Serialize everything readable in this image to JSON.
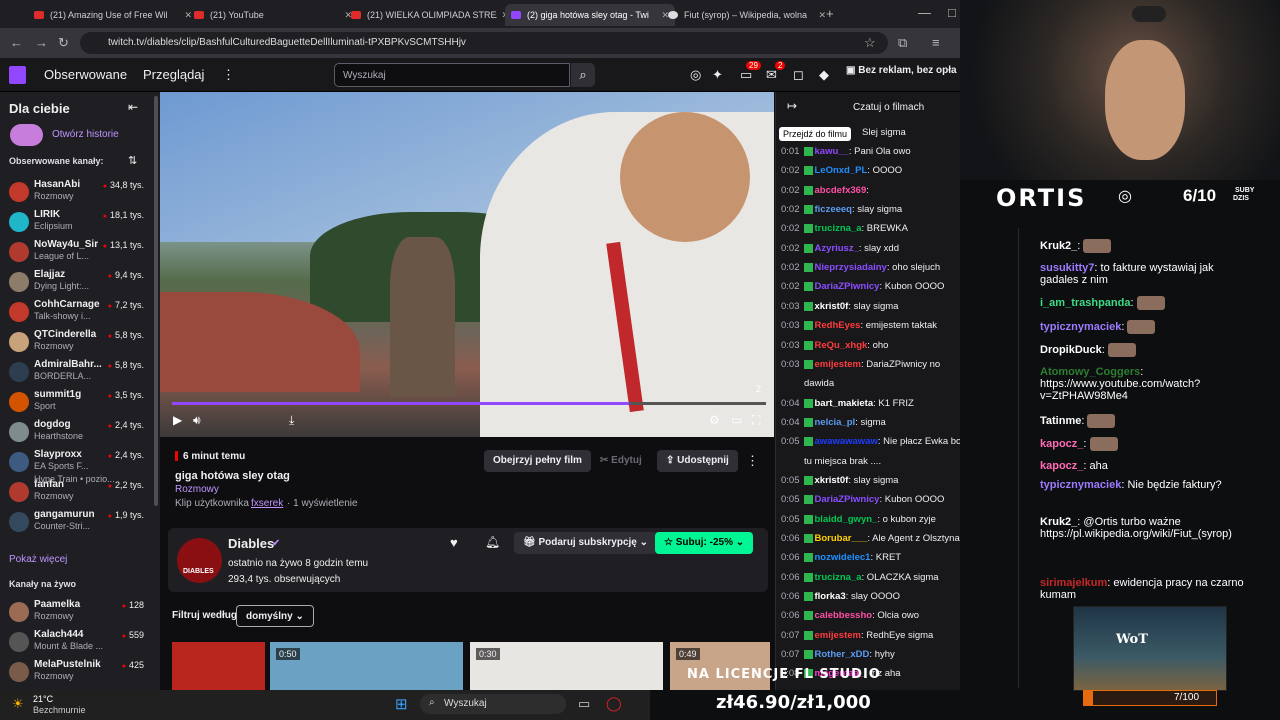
{
  "browser": {
    "tabs": [
      {
        "title": "(21) Amazing Use of Free Wil",
        "kind": "yt"
      },
      {
        "title": "(21) YouTube",
        "kind": "yt"
      },
      {
        "title": "(21) WIELKA OLIMPIADA STREA",
        "kind": "yt"
      },
      {
        "title": "(2) giga hotówa sley otag - Twi",
        "kind": "tw"
      },
      {
        "title": "Fiut (syrop) – Wikipedia, wolna",
        "kind": "wk"
      }
    ],
    "url": "twitch.tv/diables/clip/BashfulCulturedBaguetteDellIluminati-tPXBPKvSCMTSHHjv"
  },
  "topnav": {
    "following": "Obserwowane",
    "browse": "Przeglądaj",
    "search_placeholder": "Wyszukaj",
    "badge_notifications": "29",
    "badge_inbox": "2",
    "no_ads": "Bez reklam, bez opła"
  },
  "sidebar": {
    "for_you": "Dla ciebie",
    "open_stories": "Otwórz historie",
    "followed_channels": "Obserwowane kanały:",
    "channels": [
      {
        "name": "HasanAbi",
        "game": "Rozmowy",
        "viewers": "34,8 tys.",
        "color": "#c0392b"
      },
      {
        "name": "LIRIK",
        "game": "Eclipsium",
        "viewers": "18,1 tys.",
        "color": "#1fb6c9"
      },
      {
        "name": "NoWay4u_Sir",
        "game": "League of L...",
        "viewers": "13,1 tys.",
        "color": "#b03a2e"
      },
      {
        "name": "Elajjaz",
        "game": "Dying Light:...",
        "viewers": "9,4 tys.",
        "color": "#8e7c6a"
      },
      {
        "name": "CohhCarnage",
        "game": "Talk-showy i...",
        "viewers": "7,2 tys.",
        "color": "#c0392b"
      },
      {
        "name": "QTCinderella",
        "game": "Rozmowy",
        "viewers": "5,8 tys.",
        "color": "#c8a27a"
      },
      {
        "name": "AdmiralBahr...",
        "game": "BORDERLA...",
        "viewers": "5,8 tys.",
        "color": "#2c3e50"
      },
      {
        "name": "summit1g",
        "game": "Sport",
        "viewers": "3,5 tys.",
        "color": "#d35400"
      },
      {
        "name": "dogdog",
        "game": "Hearthstone",
        "viewers": "2,4 tys.",
        "color": "#7f8c8d"
      },
      {
        "name": "Slayproxx",
        "game": "EA Sports F...",
        "viewers": "2,4 tys.",
        "color": "#3d5a80"
      },
      {
        "name": "fanfan",
        "game": "Rozmowy",
        "viewers": "2,2 tys.",
        "color": "#b03a2e"
      },
      {
        "name": "gangamurun",
        "game": "Counter-Stri...",
        "viewers": "1,9 tys.",
        "color": "#34495e"
      }
    ],
    "hype_train": "Hype Train • pozio...",
    "show_more": "Pokaż więcej",
    "live_channels": "Kanały na żywo",
    "live": [
      {
        "name": "Paamelka",
        "game": "Rozmowy",
        "viewers": "128",
        "color": "#9c6b54"
      },
      {
        "name": "Kalach444",
        "game": "Mount & Blade ...",
        "viewers": "559",
        "color": "#555"
      },
      {
        "name": "MelaPustelnik",
        "game": "Rozmowy",
        "viewers": "425",
        "color": "#7a5a48"
      }
    ]
  },
  "video": {
    "progress": 0.77,
    "corner_num": "2"
  },
  "clip": {
    "age": "6 minut temu",
    "title": "giga hotówa sley otag",
    "category": "Rozmowy",
    "clip_by": "Klip użytkownika",
    "clipper": "fxserek",
    "views": "· 1 wyświetlenie",
    "watch_full": "Obejrzyj pełny film",
    "edit": "Edytuj",
    "share": "Udostępnij"
  },
  "channel": {
    "name": "Diables",
    "last_live": "ostatnio na żywo 8 godzin temu",
    "followers": "293,4 tys. obserwujących",
    "gift": "Podaruj subskrypcję",
    "subscribe": "Subuj: -25%",
    "filter_label": "Filtruj według",
    "filter_value": "domyślny",
    "avatar_text": "DIABLES"
  },
  "thumbs": [
    {
      "dur": "0:50"
    },
    {
      "dur": "0:30"
    },
    {
      "dur": "0:49"
    }
  ],
  "chat": {
    "header": "Czatuj o filmach",
    "tooltip": "Przejdź do filmu",
    "partial": "Slej sigma",
    "messages": [
      {
        "t": "0:01",
        "u": "kawu__",
        "m": "Pani Ola owo",
        "c": "#9147ff"
      },
      {
        "t": "0:02",
        "u": "LeOnxd_PL",
        "m": "OOOO",
        "c": "#1e90ff"
      },
      {
        "t": "0:02",
        "u": "abcdefx369",
        "m": "",
        "c": "#ff4fa3"
      },
      {
        "t": "0:02",
        "u": "ficzeeeq",
        "m": "slay sigma",
        "c": "#5b9cf2"
      },
      {
        "t": "0:02",
        "u": "trucizna_a",
        "m": "BREWKA",
        "c": "#00c853"
      },
      {
        "t": "0:02",
        "u": "Azyriusz_",
        "m": "slay xdd",
        "c": "#8a4dff"
      },
      {
        "t": "0:02",
        "u": "Nieprzysiadainy",
        "m": "oho slejuch",
        "c": "#8a4dff"
      },
      {
        "t": "0:02",
        "u": "DariaZPiwnicy",
        "m": "Kubon OOOO",
        "c": "#8a4dff"
      },
      {
        "t": "0:03",
        "u": "xkrist0f",
        "m": "slay sigma",
        "c": "#ffffff"
      },
      {
        "t": "0:03",
        "u": "RedhEyes",
        "m": "emijestem taktak",
        "c": "#ff3b3b"
      },
      {
        "t": "0:03",
        "u": "ReQu_xhgk",
        "m": "oho",
        "c": "#ff3b3b"
      },
      {
        "t": "0:03",
        "u": "emijestem",
        "m": "DariaZPiwnicy no",
        "c": "#ff3b3b"
      },
      {
        "t": "",
        "u": "",
        "m": "dawida",
        "c": "#ffffff"
      },
      {
        "t": "0:04",
        "u": "bart_makieta",
        "m": "K1 FRIZ",
        "c": "#ffffff"
      },
      {
        "t": "0:04",
        "u": "nelcia_pl",
        "m": "sigma",
        "c": "#5b9cf2"
      },
      {
        "t": "0:05",
        "u": "awawawawaw",
        "m": "Nie płacz Ewka bo",
        "c": "#1e3cff"
      },
      {
        "t": "",
        "u": "",
        "m": "tu miejsca brak ....",
        "c": "#ffffff"
      },
      {
        "t": "0:05",
        "u": "xkrist0f",
        "m": "slay sigma",
        "c": "#ffffff"
      },
      {
        "t": "0:05",
        "u": "DariaZPiwnicy",
        "m": "Kubon OOOO",
        "c": "#8a4dff"
      },
      {
        "t": "0:05",
        "u": "blaidd_gwyn_",
        "m": "o kubon zyje",
        "c": "#00c853"
      },
      {
        "t": "0:06",
        "u": "Borubar___",
        "m": "Ale Agent z Olsztyna",
        "c": "#ffd000"
      },
      {
        "t": "0:06",
        "u": "nozwidelec1",
        "m": "KRET",
        "c": "#1e90ff"
      },
      {
        "t": "0:06",
        "u": "trucizna_a",
        "m": "OLACZKA sigma",
        "c": "#00c853"
      },
      {
        "t": "0:06",
        "u": "florka3",
        "m": "slay OOOO",
        "c": "#ffffff"
      },
      {
        "t": "0:06",
        "u": "calebbessho",
        "m": "Olcia owo",
        "c": "#ff4fa3"
      },
      {
        "t": "0:07",
        "u": "emijestem",
        "m": "RedhEye sigma",
        "c": "#ff3b3b"
      },
      {
        "t": "0:07",
        "u": "Rother_xDD",
        "m": "hyhy",
        "c": "#5b9cf2"
      },
      {
        "t": "0:08",
        "u": "magentaa_",
        "m": "friz aha",
        "c": "#ff3bd1"
      }
    ]
  },
  "overlay": {
    "brand": "ORTIS",
    "sub_count": "6/10",
    "sub_label_1": "SUBY",
    "sub_label_2": "DZIS",
    "messages": [
      {
        "u": "Kruk2_",
        "m": "",
        "c": "#ffffff"
      },
      {
        "u": "susukitty7",
        "m": "to fakture wystawiaj jak gadales z nim",
        "c": "#9d7bff"
      },
      {
        "u": "i_am_trashpanda",
        "m": "",
        "c": "#3ddc84"
      },
      {
        "u": "typicznymaciek",
        "m": "",
        "c": "#9d7bff"
      },
      {
        "u": "DropikDuck",
        "m": "",
        "c": "#ffffff"
      },
      {
        "u": "Atomowy_Coggers",
        "m": "https://www.youtube.com/watch?v=ZtPHAW98Me4",
        "c": "#2e7d32"
      },
      {
        "u": "Tatinme",
        "m": "",
        "c": "#ffffff"
      },
      {
        "u": "kapocz_",
        "m": "",
        "c": "#ff6bb5"
      },
      {
        "u": "kapocz_",
        "m": "aha",
        "c": "#ff6bb5"
      },
      {
        "u": "typicznymaciek",
        "m": "Nie będzie faktury?",
        "c": "#9d7bff"
      },
      {
        "u": "Kruk2_",
        "m": "@Ortis turbo ważne https://pl.wikipedia.org/wiki/Fiut_(syrop)",
        "c": "#ffffff"
      },
      {
        "u": "sirimajelkum",
        "m": "ewidencja pracy na czarno kumam",
        "c": "#c62828"
      }
    ],
    "licence": "NA LICENCJE FL STUDIO",
    "price": "zł46.90/zł1,000",
    "goal": "7/100",
    "goal_fraction": 0.07
  },
  "taskbar": {
    "temp": "21°C",
    "weather": "Bezchmurnie",
    "search": "Wyszukaj"
  }
}
